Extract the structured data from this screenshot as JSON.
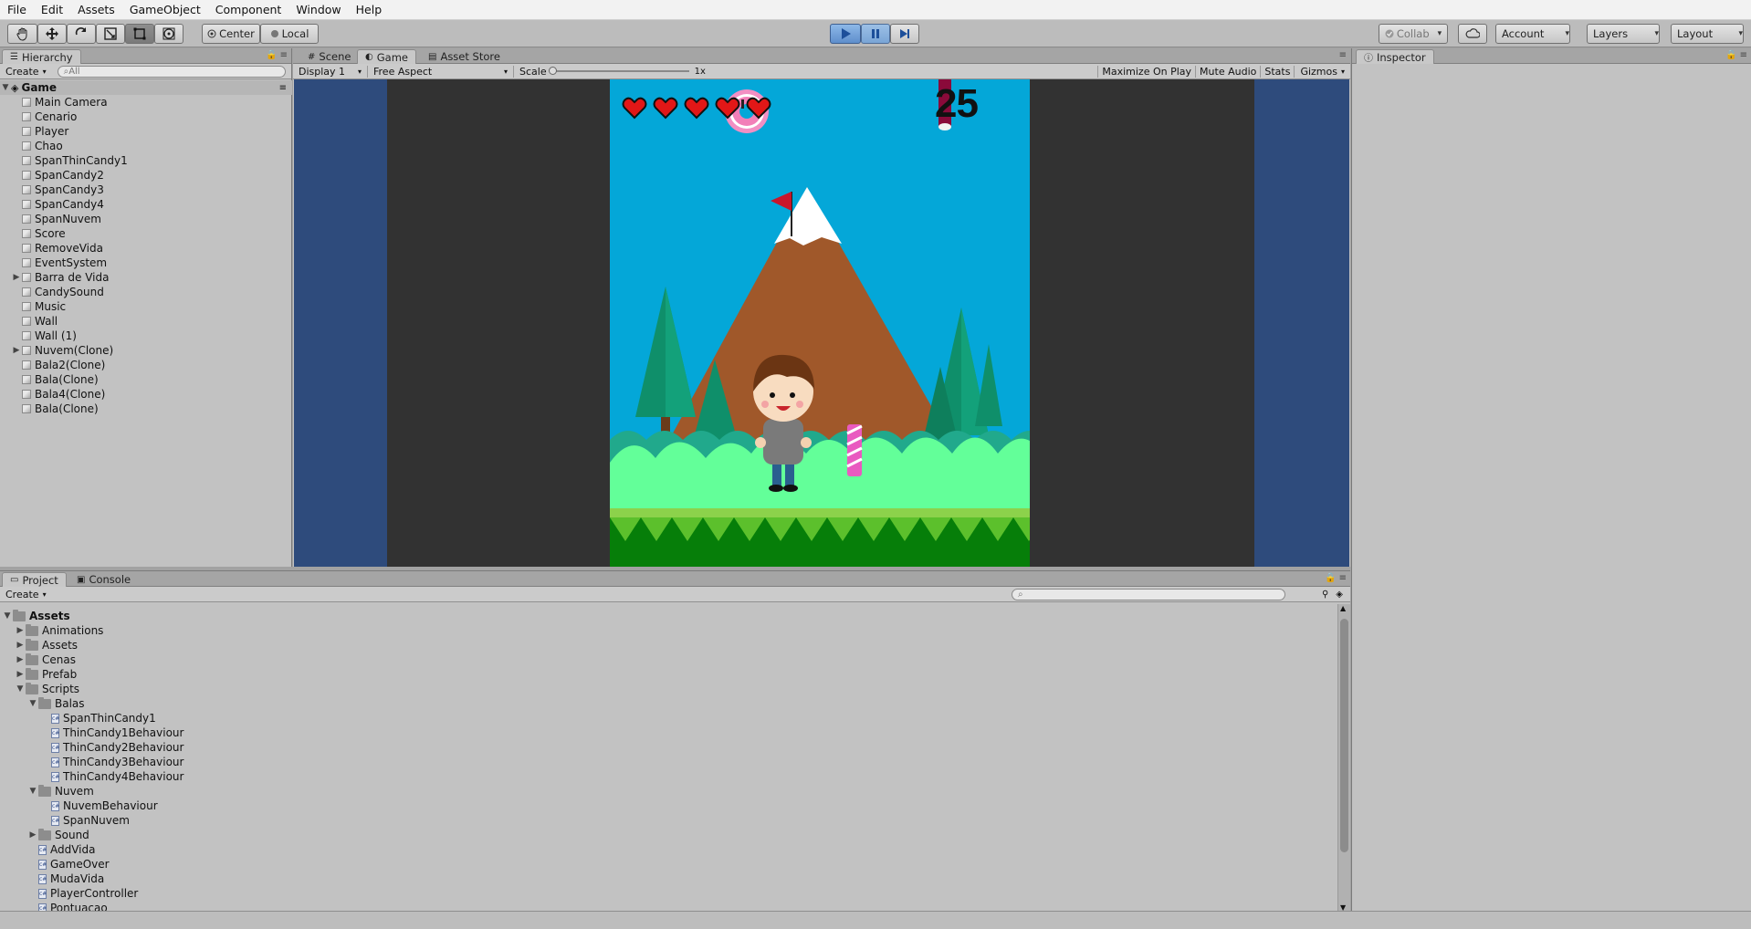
{
  "menu": [
    "File",
    "Edit",
    "Assets",
    "GameObject",
    "Component",
    "Window",
    "Help"
  ],
  "toolbar": {
    "pivot_center": "Center",
    "pivot_local": "Local",
    "collab": "Collab",
    "account": "Account",
    "layers": "Layers",
    "layout": "Layout"
  },
  "hierarchy": {
    "tab": "Hierarchy",
    "create": "Create",
    "search_placeholder": "All",
    "scene": "Game",
    "items": [
      {
        "label": "Main Camera",
        "expandable": false
      },
      {
        "label": "Cenario",
        "expandable": false
      },
      {
        "label": "Player",
        "expandable": false
      },
      {
        "label": "Chao",
        "expandable": false
      },
      {
        "label": "SpanThinCandy1",
        "expandable": false
      },
      {
        "label": "SpanCandy2",
        "expandable": false
      },
      {
        "label": "SpanCandy3",
        "expandable": false
      },
      {
        "label": "SpanCandy4",
        "expandable": false
      },
      {
        "label": "SpanNuvem",
        "expandable": false
      },
      {
        "label": "Score",
        "expandable": false
      },
      {
        "label": "RemoveVida",
        "expandable": false
      },
      {
        "label": "EventSystem",
        "expandable": false
      },
      {
        "label": "Barra de Vida",
        "expandable": true
      },
      {
        "label": "CandySound",
        "expandable": false
      },
      {
        "label": "Music",
        "expandable": false
      },
      {
        "label": "Wall",
        "expandable": false
      },
      {
        "label": "Wall (1)",
        "expandable": false
      },
      {
        "label": "Nuvem(Clone)",
        "expandable": true
      },
      {
        "label": "Bala2(Clone)",
        "expandable": false
      },
      {
        "label": "Bala(Clone)",
        "expandable": false
      },
      {
        "label": "Bala4(Clone)",
        "expandable": false
      },
      {
        "label": "Bala(Clone)",
        "expandable": false
      }
    ]
  },
  "center_tabs": {
    "scene": "Scene",
    "game": "Game",
    "asset_store": "Asset Store"
  },
  "game_bar": {
    "display": "Display 1",
    "aspect": "Free Aspect",
    "scale_label": "Scale",
    "scale_value": "1x",
    "maximize": "Maximize On Play",
    "mute": "Mute Audio",
    "stats": "Stats",
    "gizmos": "Gizmos"
  },
  "game": {
    "score": "25",
    "hearts": 5
  },
  "inspector": {
    "tab": "Inspector"
  },
  "project": {
    "tab_project": "Project",
    "tab_console": "Console",
    "create": "Create",
    "items": [
      {
        "label": "Assets",
        "depth": 0,
        "kind": "folder",
        "arrow": "open",
        "bold": true
      },
      {
        "label": "Animations",
        "depth": 1,
        "kind": "folder",
        "arrow": "closed"
      },
      {
        "label": "Assets",
        "depth": 1,
        "kind": "folder",
        "arrow": "closed"
      },
      {
        "label": "Cenas",
        "depth": 1,
        "kind": "folder",
        "arrow": "closed"
      },
      {
        "label": "Prefab",
        "depth": 1,
        "kind": "folder",
        "arrow": "closed"
      },
      {
        "label": "Scripts",
        "depth": 1,
        "kind": "folder",
        "arrow": "open"
      },
      {
        "label": "Balas",
        "depth": 2,
        "kind": "folder",
        "arrow": "open"
      },
      {
        "label": "SpanThinCandy1",
        "depth": 3,
        "kind": "script"
      },
      {
        "label": "ThinCandy1Behaviour",
        "depth": 3,
        "kind": "script"
      },
      {
        "label": "ThinCandy2Behaviour",
        "depth": 3,
        "kind": "script"
      },
      {
        "label": "ThinCandy3Behaviour",
        "depth": 3,
        "kind": "script"
      },
      {
        "label": "ThinCandy4Behaviour",
        "depth": 3,
        "kind": "script"
      },
      {
        "label": "Nuvem",
        "depth": 2,
        "kind": "folder",
        "arrow": "open"
      },
      {
        "label": "NuvemBehaviour",
        "depth": 3,
        "kind": "script"
      },
      {
        "label": "SpanNuvem",
        "depth": 3,
        "kind": "script"
      },
      {
        "label": "Sound",
        "depth": 2,
        "kind": "folder",
        "arrow": "closed"
      },
      {
        "label": "AddVida",
        "depth": 2,
        "kind": "script"
      },
      {
        "label": "GameOver",
        "depth": 2,
        "kind": "script"
      },
      {
        "label": "MudaVida",
        "depth": 2,
        "kind": "script"
      },
      {
        "label": "PlayerController",
        "depth": 2,
        "kind": "script"
      },
      {
        "label": "Pontuacao",
        "depth": 2,
        "kind": "script"
      }
    ]
  }
}
